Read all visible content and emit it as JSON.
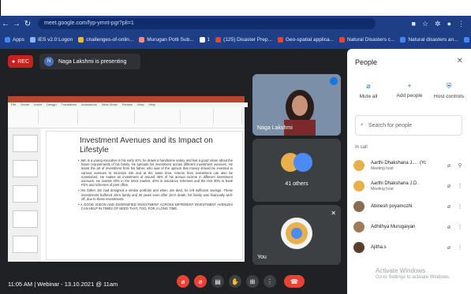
{
  "browser": {
    "url": "meet.google.com/fyp-ymnt-pgr?pli=1",
    "bookmarks": [
      {
        "label": "Apps",
        "color": "#4285f4"
      },
      {
        "label": "IES v2.0:Logon",
        "color": "#8ab4f8"
      },
      {
        "label": "challenges-of-onlin...",
        "color": "#fbbc04"
      },
      {
        "label": "Murugan Potti Sub...",
        "color": "#f28b82"
      },
      {
        "label": "1",
        "color": "#ffffff"
      },
      {
        "label": "(125) Disaster Prep...",
        "color": "#ea4335"
      },
      {
        "label": "Geo-spatial applica...",
        "color": "#ea4335"
      },
      {
        "label": "Natural Disasters c...",
        "color": "#ea4335"
      },
      {
        "label": "Natural disasters an...",
        "color": "#4285f4"
      },
      {
        "label": "Reading li",
        "color": "#4285f4"
      }
    ]
  },
  "meet": {
    "rec_label": "REC",
    "presenter_initial": "N",
    "presenter_banner": "Naga Lakshmi is presenting",
    "time": "11:05 AM",
    "meeting_name": "Webinar - 13.10.2021 @ 11am",
    "tiles": {
      "speaker_name": "Naga Lakshmi",
      "others_count": "41 others",
      "self_label": "You"
    }
  },
  "slide": {
    "title": "Investment Avenues and its Impact on Lifestyle",
    "bullets": [
      "Jam is a young executive in his early 40's; he draws a handsome salary and has a good vision about the future requirements of his family. He spreads his investment across different investment avenues. He learnt the art of investment from his father, who was of the opinion that money should be invested in various avenues to minimize risk and at the same time, returns from investment can also be maintained. He makes an investment of around 45% of his annual income in different investment avenues. He invests 30% in the stock market, 40% in insurance schemes and the rest 30% in bank FD's and schemes of post office.",
      "His father Jim had designed a similar portfolio and when Jim died, he left sufficient savings. These investments buffered Jim's family and 20 years even after Jim's death, his family was financially well-off, due to these investments.",
      "A GOOD VISION AND DIVERSIFIED INVESTMENT ACROSS DIFFERENT INVESTMENT AVENUES CAN HELP IN TIMES OF NEED THAT, TOO, FOR A LONG TIME."
    ],
    "ribbon_tabs": [
      "File",
      "Home",
      "Insert",
      "Design",
      "Transitions",
      "Animations",
      "Slide Show",
      "Review",
      "View",
      "Help"
    ]
  },
  "people_panel": {
    "title": "People",
    "actions": [
      {
        "label": "Mute all",
        "icon": "mic-off-icon"
      },
      {
        "label": "Add people",
        "icon": "add-person-icon"
      },
      {
        "label": "Host controls",
        "icon": "shield-icon"
      }
    ],
    "search_placeholder": "Search for people",
    "section_label": "In call",
    "participants": [
      {
        "name": "Aarthi Dhakshana J....",
        "suffix": "(You)",
        "sub": "Meeting host",
        "color": "#e8b04a"
      },
      {
        "name": "Aarthi Dhakshana J.D.",
        "suffix": "",
        "sub": "Meeting host",
        "color": "#e8b04a"
      },
      {
        "name": "Abinesh poyamozhi",
        "suffix": "",
        "sub": "",
        "color": "#8a6a52"
      },
      {
        "name": "Adhithya Murugaiyan",
        "suffix": "",
        "sub": "",
        "color": "#9e7b5a"
      },
      {
        "name": "Ajitha.s",
        "suffix": "",
        "sub": "",
        "color": "#5a3d2b"
      }
    ]
  },
  "watermark": {
    "line1": "Activate Windows",
    "line2": "Go to Settings to activate Windows."
  },
  "colors": {
    "meet_bg": "#202124",
    "end_call": "#ea4335",
    "chrome_bar": "#1e3f86"
  }
}
